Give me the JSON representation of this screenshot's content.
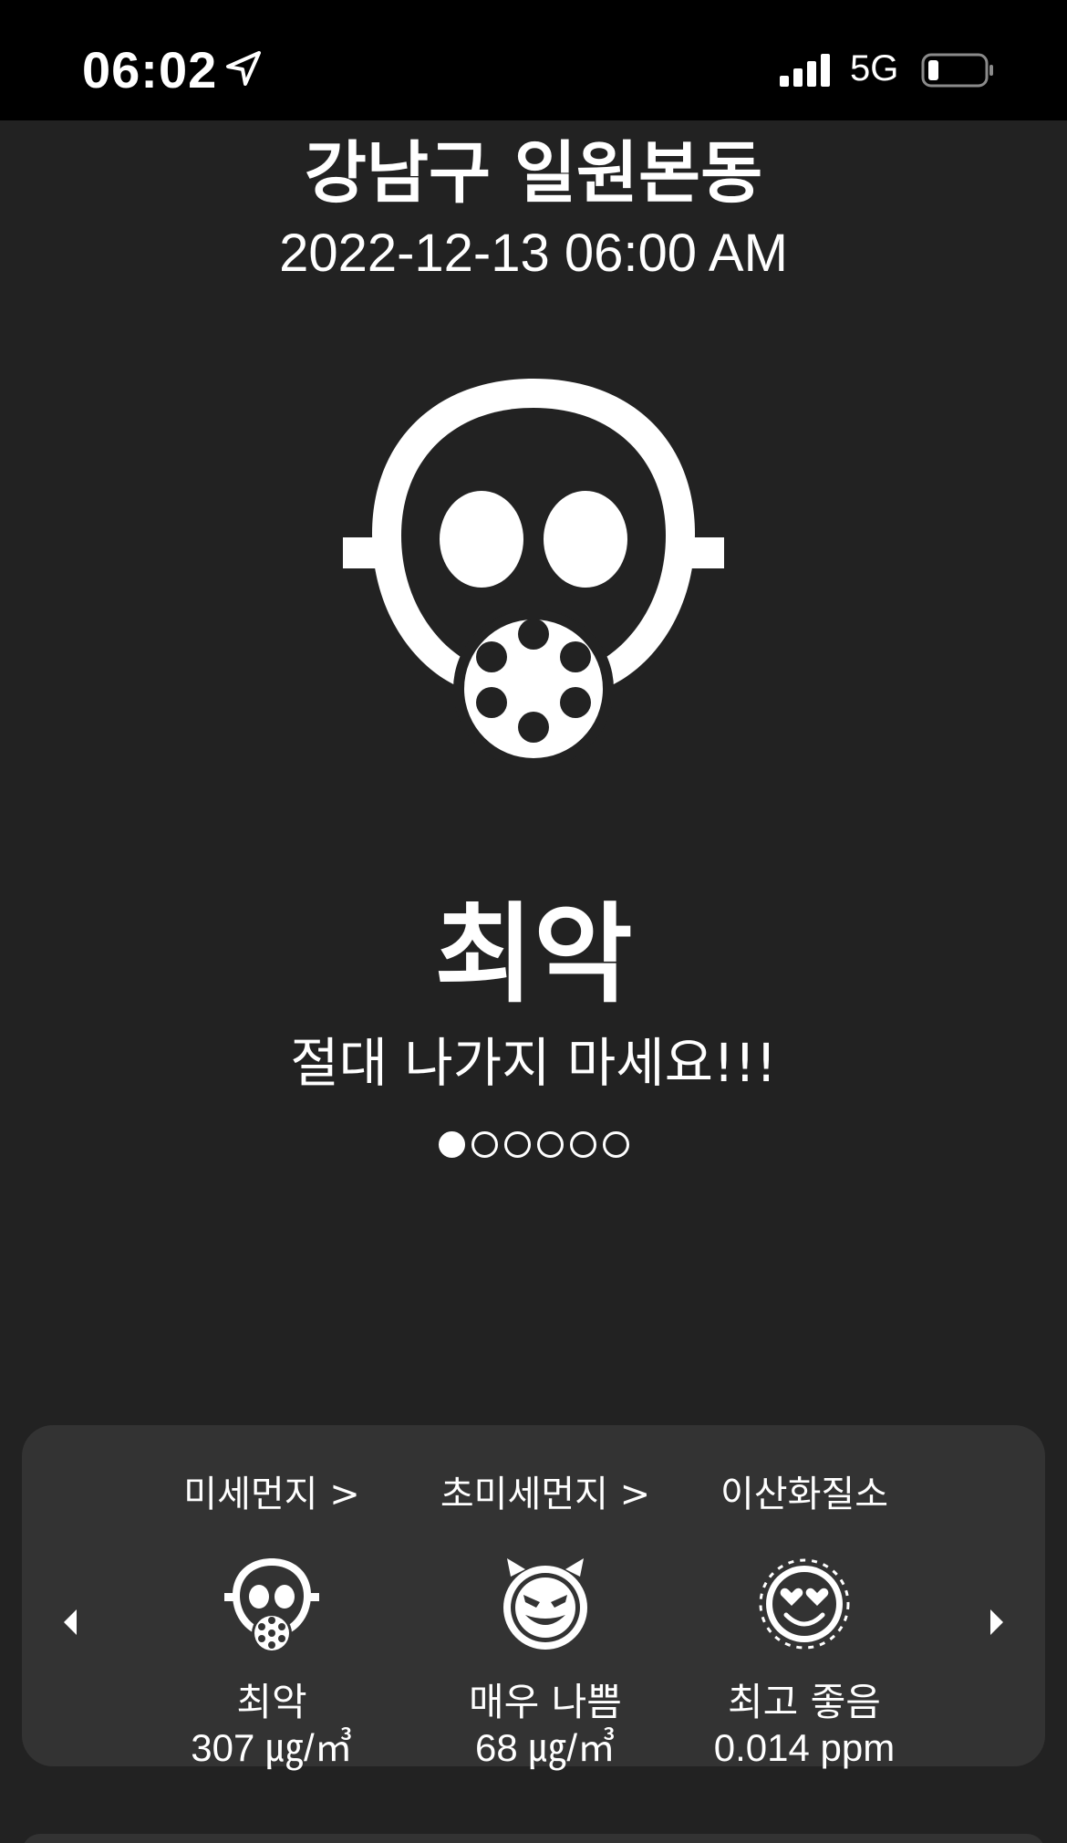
{
  "status_bar": {
    "time": "06:02",
    "network": "5G",
    "icons": [
      "location-arrow-icon",
      "cellular-signal-icon",
      "battery-low-icon"
    ]
  },
  "location": {
    "name": "강남구 일원본동",
    "datetime": "2022-12-13 06:00 AM"
  },
  "summary": {
    "icon": "gas-mask-icon",
    "status": "최악",
    "message": "절대 나가지 마세요!!!",
    "page_count": 6,
    "active_page": 0
  },
  "pollutants": [
    {
      "title": "미세먼지 >",
      "icon": "gas-mask-icon",
      "status": "최악",
      "value": "307 ㎍/㎥"
    },
    {
      "title": "초미세먼지 >",
      "icon": "devil-face-icon",
      "status": "매우 나쁨",
      "value": "68 ㎍/㎥"
    },
    {
      "title": "이산화질소",
      "icon": "heart-eyes-face-icon",
      "status": "최고 좋음",
      "value": "0.014 ppm"
    }
  ],
  "colors": {
    "background": "#222222",
    "card": "#333333",
    "status_bar": "#000000",
    "text": "#ffffff"
  }
}
